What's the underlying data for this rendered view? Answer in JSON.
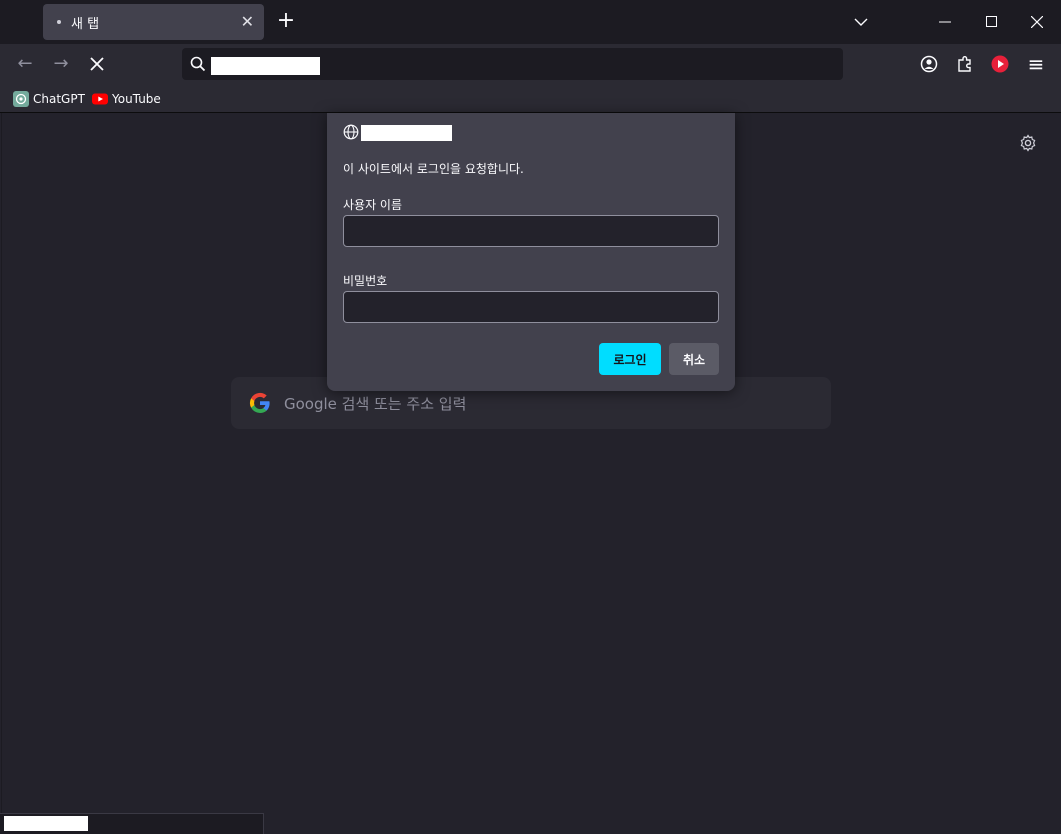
{
  "tab": {
    "title": "새 탭",
    "close_glyph": "✕"
  },
  "toolbar": {
    "new_tab_glyph": "+",
    "back_glyph": "←",
    "forward_glyph": "→",
    "stop_glyph": "✕",
    "menu_glyph": "≡"
  },
  "window": {
    "list_all_tabs_glyph": "⌵",
    "minimize_glyph": "—",
    "maximize_glyph": "☐",
    "close_glyph": "✕"
  },
  "bookmarks": [
    {
      "label": "ChatGPT",
      "icon": "chatgpt-icon"
    },
    {
      "label": "YouTube",
      "icon": "youtube-icon"
    }
  ],
  "newtab": {
    "search_placeholder": "Google 검색 또는 주소 입력",
    "settings_icon": "gear-icon"
  },
  "dialog": {
    "message": "이 사이트에서 로그인을 요청합니다.",
    "username_label": "사용자 이름",
    "username_value": "",
    "password_label": "비밀번호",
    "password_value": "",
    "login_label": "로그인",
    "cancel_label": "취소"
  },
  "colors": {
    "accent": "#00ddff",
    "background": "#23222b",
    "toolbar": "#2b2a33",
    "dialog": "#42414d"
  }
}
